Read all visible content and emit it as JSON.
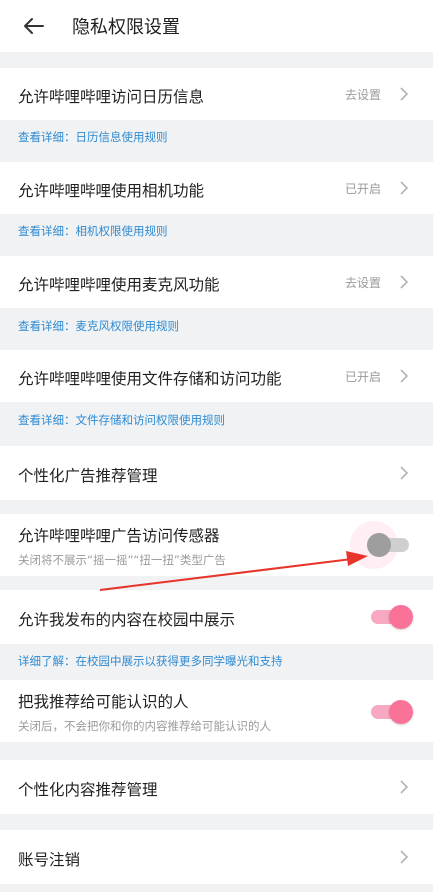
{
  "header": {
    "title": "隐私权限设置",
    "back_icon": "arrow-left-icon"
  },
  "rows": [
    {
      "label": "允许哔哩哔哩访问日历信息",
      "status": "去设置",
      "link": "查看详细：日历信息使用规则"
    },
    {
      "label": "允许哔哩哔哩使用相机功能",
      "status": "已开启",
      "link": "查看详细：相机权限使用规则"
    },
    {
      "label": "允许哔哩哔哩使用麦克风功能",
      "status": "去设置",
      "link": "查看详细：麦克风权限使用规则"
    },
    {
      "label": "允许哔哩哔哩使用文件存储和访问功能",
      "status": "已开启",
      "link": "查看详细：文件存储和访问权限使用规则"
    }
  ],
  "ad_management": {
    "label": "个性化广告推荐管理"
  },
  "sensor": {
    "label": "允许哔哩哔哩广告访问传感器",
    "sub": "关闭将不展示“摇一摇”“扭一扭”类型广告",
    "enabled": false
  },
  "campus": {
    "label": "允许我发布的内容在校园中展示",
    "link": "详细了解：在校园中展示以获得更多同学曝光和支持",
    "enabled": true
  },
  "recommend": {
    "label": "把我推荐给可能认识的人",
    "sub": "关闭后，不会把你和你的内容推荐给可能认识的人",
    "enabled": true
  },
  "content_management": {
    "label": "个性化内容推荐管理"
  },
  "account": {
    "label": "账号注销"
  },
  "colors": {
    "accent": "#fb7299",
    "link": "#2e8bd1",
    "annotation": "#e8352b"
  }
}
